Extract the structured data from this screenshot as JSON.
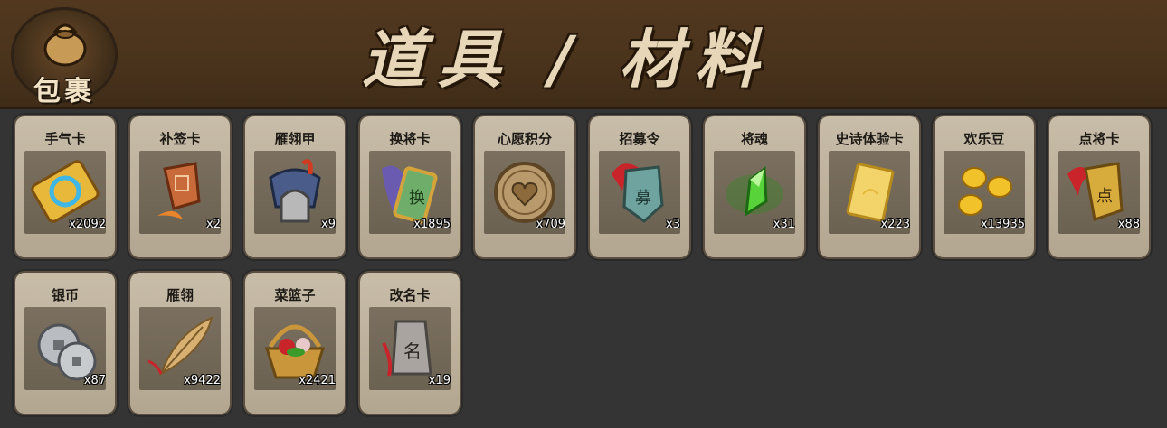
{
  "header": {
    "badge_label": "包裹",
    "title": "道具 / 材料"
  },
  "items": [
    {
      "name": "手气卡",
      "count": "x2092",
      "icon": "luck-card-icon"
    },
    {
      "name": "补签卡",
      "count": "x2",
      "icon": "resign-card-icon"
    },
    {
      "name": "雁翎甲",
      "count": "x9",
      "icon": "armor-icon"
    },
    {
      "name": "换将卡",
      "count": "x1895",
      "icon": "swap-general-card-icon"
    },
    {
      "name": "心愿积分",
      "count": "x709",
      "icon": "wish-coin-icon"
    },
    {
      "name": "招募令",
      "count": "x3",
      "icon": "recruit-token-icon"
    },
    {
      "name": "将魂",
      "count": "x31",
      "icon": "soul-crystal-icon"
    },
    {
      "name": "史诗体验卡",
      "count": "x223",
      "icon": "epic-trial-card-icon"
    },
    {
      "name": "欢乐豆",
      "count": "x13935",
      "icon": "gold-beans-icon"
    },
    {
      "name": "点将卡",
      "count": "x88",
      "icon": "select-general-card-icon"
    },
    {
      "name": "银币",
      "count": "x87",
      "icon": "silver-coin-icon"
    },
    {
      "name": "雁翎",
      "count": "x9422",
      "icon": "feather-icon"
    },
    {
      "name": "菜篮子",
      "count": "x2421",
      "icon": "basket-icon"
    },
    {
      "name": "改名卡",
      "count": "x19",
      "icon": "rename-card-icon"
    }
  ]
}
